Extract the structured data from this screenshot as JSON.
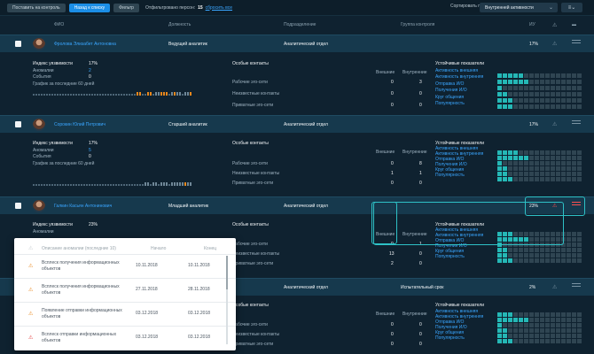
{
  "toolbar": {
    "to_control_label": "Поставить на контроль",
    "back_label": "Назад к списку",
    "filter_label": "Фильтр",
    "filtered_label": "Отфильтровано персон:",
    "filtered_count": "15",
    "reset_label": "сбросить все",
    "sort_label": "Сортировать по",
    "sort_value": "Внутренней активности",
    "sort_icon": "chevron-down-icon",
    "list_icon": "sort-list-icon"
  },
  "columns": {
    "fio": "ФИО",
    "position": "Должность",
    "department": "Подразделение",
    "group": "Группа контроля",
    "iu": "ИУ",
    "warn_icon": "warning-icon",
    "menu_icon": "menu-icon"
  },
  "detail_labels": {
    "index": "Индекс уязвимости",
    "anomalies": "Аномалии",
    "events": "События",
    "graph": "График за последние 60 дней",
    "special": "Особые контакты",
    "working_ego": "Рабочие эго-сети",
    "unknown_ego": "Неизвестные контакты",
    "private_ego": "Приватные эго-сети",
    "external": "Внешние",
    "internal": "Внутренние",
    "stable": "Устойчивые показатели",
    "act_ext": "Активность внешняя",
    "act_int": "Активность внутренняя",
    "send_io": "Отправка И/О",
    "recv_io": "Получения И/О",
    "circle": "Круг общения",
    "popularity": "Популярность"
  },
  "persons": [
    {
      "name": "Фролова Элизабет Антоновна",
      "position": "Ведущий аналитик",
      "department": "Аналитический отдел",
      "group": "",
      "iu": "17%",
      "index": "17%",
      "anomalies": "2",
      "events": "0",
      "special": [
        [
          "0",
          "3"
        ],
        [
          "0",
          "0"
        ],
        [
          "0",
          "0"
        ]
      ],
      "stable": [
        5,
        6,
        1,
        2,
        3,
        3
      ]
    },
    {
      "name": "Сорокин Юлий Петрович",
      "position": "Старший аналитик",
      "department": "Аналитический отдел",
      "group": "",
      "iu": "17%",
      "index": "17%",
      "anomalies": "5",
      "events": "0",
      "special": [
        [
          "0",
          "8"
        ],
        [
          "1",
          "1"
        ],
        [
          "0",
          "0"
        ]
      ],
      "stable": [
        4,
        6,
        1,
        2,
        2,
        3
      ]
    },
    {
      "name": "Галкин Касьян Антонинович",
      "position": "Младший аналитик",
      "department": "Аналитический отдел",
      "group": "",
      "iu": "23%",
      "index": "23%",
      "anomalies": "",
      "events": "",
      "special": [
        [
          "0",
          "1"
        ],
        [
          "13",
          "0"
        ],
        [
          "2",
          "0"
        ]
      ],
      "stable": [
        3,
        6,
        1,
        2,
        2,
        3
      ]
    },
    {
      "name": "",
      "position": "",
      "department": "Аналитический отдел",
      "group": "Испытательный срок",
      "iu": "2%",
      "index": "",
      "anomalies": "",
      "events": "",
      "special": [
        [
          "0",
          "0"
        ],
        [
          "0",
          "0"
        ],
        [
          "0",
          "0"
        ]
      ],
      "stable": [
        3,
        6,
        1,
        2,
        2,
        3
      ]
    }
  ],
  "popup": {
    "h_desc": "Описание аномалии (последние 10)",
    "h_start": "Начало",
    "h_end": "Конец",
    "rows": [
      {
        "desc": "Всплеск получения информационных объектов",
        "start": "10.11.2018",
        "end": "10.11.2018",
        "level": "orange"
      },
      {
        "desc": "Всплеск получения информационных объектов",
        "start": "27.11.2018",
        "end": "28.11.2018",
        "level": "orange"
      },
      {
        "desc": "Появление отправки информационных объектов",
        "start": "03.12.2018",
        "end": "03.12.2018",
        "level": "orange"
      },
      {
        "desc": "Всплеск отправки информационных объектов",
        "start": "03.12.2018",
        "end": "03.12.2018",
        "level": "red"
      }
    ]
  },
  "colors": {
    "accent": "#1b8ee6",
    "teal": "#25b8b6",
    "orange": "#e8871c",
    "red": "#e23c3c"
  }
}
